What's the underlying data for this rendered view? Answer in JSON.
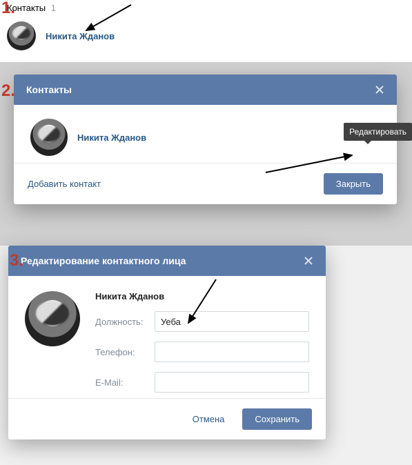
{
  "step1": {
    "heading": "Контакты",
    "count": "1",
    "contact_name": "Никита Жданов"
  },
  "step2": {
    "title": "Контакты",
    "contact_name": "Никита Жданов",
    "tooltip": "Редактировать",
    "add_contact": "Добавить контакт",
    "close_btn": "Закрыть"
  },
  "step3": {
    "title": "Редактирование контактного лица",
    "contact_name": "Никита Жданов",
    "fields": {
      "position_label": "Должность:",
      "position_value": "Уеба",
      "phone_label": "Телефон:",
      "phone_value": "",
      "email_label": "E-Mail:",
      "email_value": ""
    },
    "cancel": "Отмена",
    "save": "Сохранить"
  },
  "annotations": {
    "n1": "1.",
    "n2": "2.",
    "n3": "3."
  }
}
